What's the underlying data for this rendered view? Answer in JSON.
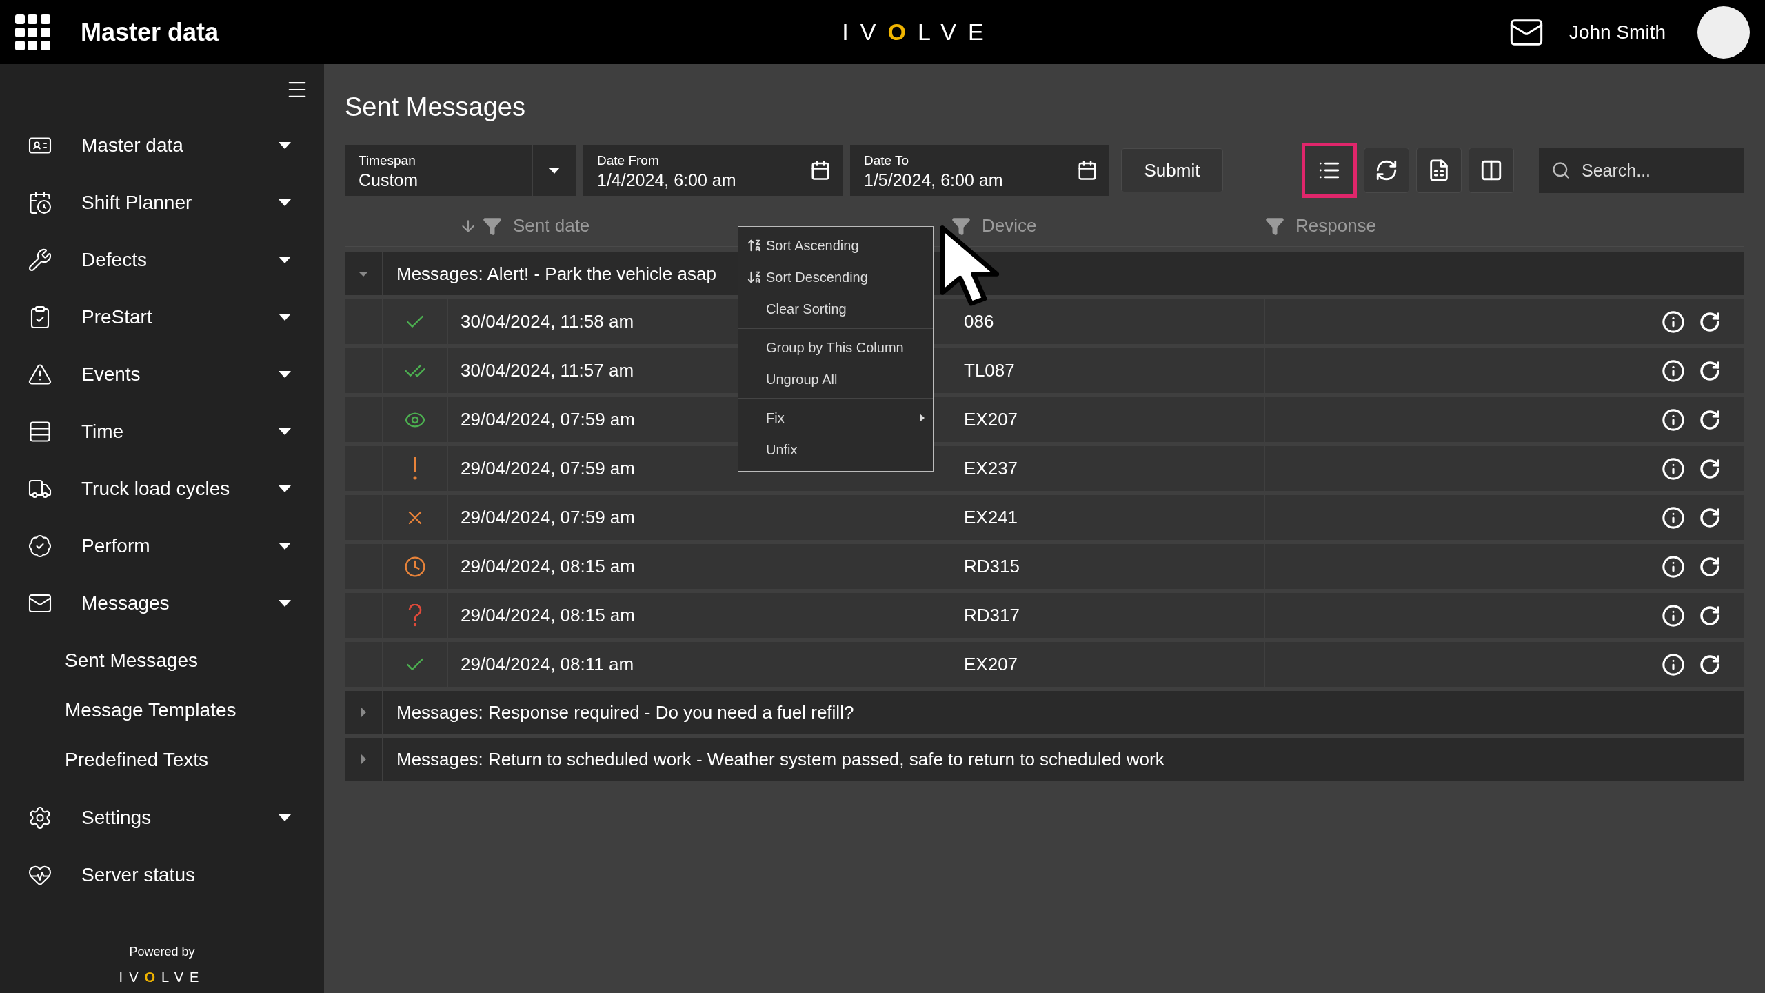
{
  "header": {
    "title": "Master data",
    "logo": {
      "parts": [
        {
          "text": "IV",
          "kind": "plain"
        },
        {
          "text": "O",
          "kind": "accent"
        },
        {
          "text": "LVE",
          "kind": "plain"
        }
      ]
    },
    "user": "John Smith"
  },
  "sidebar": {
    "items": [
      {
        "label": "Master data",
        "kind": "dropdown"
      },
      {
        "label": "Shift Planner",
        "kind": "dropdown"
      },
      {
        "label": "Defects",
        "kind": "dropdown"
      },
      {
        "label": "PreStart",
        "kind": "dropdown"
      },
      {
        "label": "Events",
        "kind": "dropdown"
      },
      {
        "label": "Time",
        "kind": "dropdown"
      },
      {
        "label": "Truck load cycles",
        "kind": "dropdown"
      },
      {
        "label": "Perform",
        "kind": "dropdown"
      },
      {
        "label": "Messages",
        "kind": "dropdown",
        "children": [
          {
            "label": "Sent Messages"
          },
          {
            "label": "Message Templates"
          },
          {
            "label": "Predefined Texts"
          }
        ]
      },
      {
        "label": "Settings",
        "kind": "dropdown"
      },
      {
        "label": "Server status",
        "kind": "link"
      }
    ],
    "footer": {
      "powered_by": "Powered by",
      "logo": {
        "parts": [
          {
            "text": "IV",
            "kind": "plain"
          },
          {
            "text": "O",
            "kind": "accent"
          },
          {
            "text": "LVE",
            "kind": "plain"
          }
        ]
      }
    }
  },
  "page": {
    "title": "Sent Messages"
  },
  "toolbar": {
    "timespan": {
      "label": "Timespan",
      "value": "Custom"
    },
    "date_from": {
      "label": "Date From",
      "value": "1/4/2024, 6:00 am"
    },
    "date_to": {
      "label": "Date To",
      "value": "1/5/2024, 6:00 am"
    },
    "submit": "Submit",
    "buttons": [
      {
        "kind": "columns",
        "selected": true
      },
      {
        "kind": "refresh",
        "selected": false
      },
      {
        "kind": "xlsx",
        "selected": false
      },
      {
        "kind": "layout",
        "selected": false
      }
    ],
    "search": {
      "placeholder": "Search..."
    }
  },
  "table": {
    "columns": [
      {
        "label": "Sent date",
        "sorted": true
      },
      {
        "label": "Device",
        "sorted": false
      },
      {
        "label": "Response",
        "sorted": false
      }
    ],
    "groups": [
      {
        "title": "Messages: Alert! - Park the vehicle asap",
        "expanded": true,
        "rows": [
          {
            "kind": "sent",
            "sent_date": "30/04/2024, 11:58 am",
            "device": "086"
          },
          {
            "kind": "delivered",
            "sent_date": "30/04/2024, 11:57 am",
            "device": "TL087"
          },
          {
            "kind": "read",
            "sent_date": "29/04/2024, 07:59 am",
            "device": "EX207"
          },
          {
            "kind": "warning",
            "sent_date": "29/04/2024, 07:59 am",
            "device": "EX237"
          },
          {
            "kind": "failed",
            "sent_date": "29/04/2024, 07:59 am",
            "device": "EX241"
          },
          {
            "kind": "pending",
            "sent_date": "29/04/2024, 08:15 am",
            "device": "RD315"
          },
          {
            "kind": "unknown",
            "sent_date": "29/04/2024, 08:15 am",
            "device": "RD317"
          },
          {
            "kind": "sent",
            "sent_date": "29/04/2024, 08:11 am",
            "device": "EX207"
          }
        ]
      },
      {
        "title": "Messages: Response required - Do you need a fuel refill?",
        "expanded": false
      },
      {
        "title": "Messages: Return to scheduled work - Weather system passed, safe to return to scheduled work",
        "expanded": false
      }
    ]
  },
  "context_menu": {
    "sections": [
      [
        {
          "label": "Sort Ascending",
          "kind": "sort_ascending"
        },
        {
          "label": "Sort Descending",
          "kind": "sort_descending"
        },
        {
          "label": "Clear Sorting",
          "kind": "plain"
        }
      ],
      [
        {
          "label": "Group by This Column"
        },
        {
          "label": "Ungroup All"
        }
      ],
      [
        {
          "label": "Fix",
          "submenu": true
        },
        {
          "label": "Unfix"
        }
      ]
    ]
  }
}
